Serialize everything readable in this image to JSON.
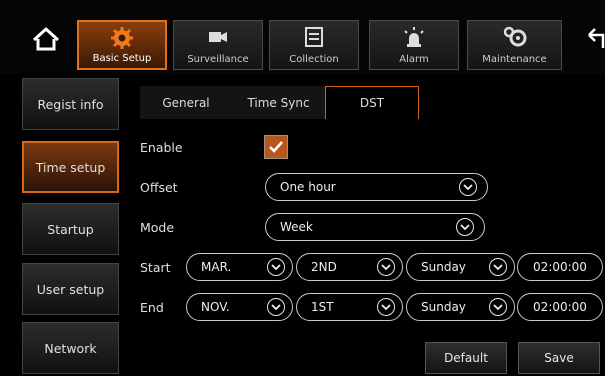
{
  "topnav": {
    "items": [
      {
        "label": "Basic Setup",
        "icon": "gear-icon"
      },
      {
        "label": "Surveillance",
        "icon": "camera-icon"
      },
      {
        "label": "Collection",
        "icon": "list-icon"
      },
      {
        "label": "Alarm",
        "icon": "alarm-light-icon"
      },
      {
        "label": "Maintenance",
        "icon": "gears-icon"
      }
    ]
  },
  "sidebar": {
    "items": [
      {
        "label": "Regist info"
      },
      {
        "label": "Time setup"
      },
      {
        "label": "Startup"
      },
      {
        "label": "User setup"
      },
      {
        "label": "Network"
      }
    ]
  },
  "subtabs": [
    {
      "label": "General"
    },
    {
      "label": "Time Sync"
    },
    {
      "label": "DST"
    }
  ],
  "form": {
    "enable_label": "Enable",
    "enable_checked": true,
    "offset_label": "Offset",
    "offset_value": "One hour",
    "mode_label": "Mode",
    "mode_value": "Week",
    "start_label": "Start",
    "start": {
      "month": "MAR.",
      "week": "2ND",
      "day": "Sunday",
      "time": "02:00:00"
    },
    "end_label": "End",
    "end": {
      "month": "NOV.",
      "week": "1ST",
      "day": "Sunday",
      "time": "02:00:00"
    }
  },
  "actions": {
    "default_label": "Default",
    "save_label": "Save"
  },
  "colors": {
    "accent": "#e0701c",
    "background": "#000000"
  }
}
